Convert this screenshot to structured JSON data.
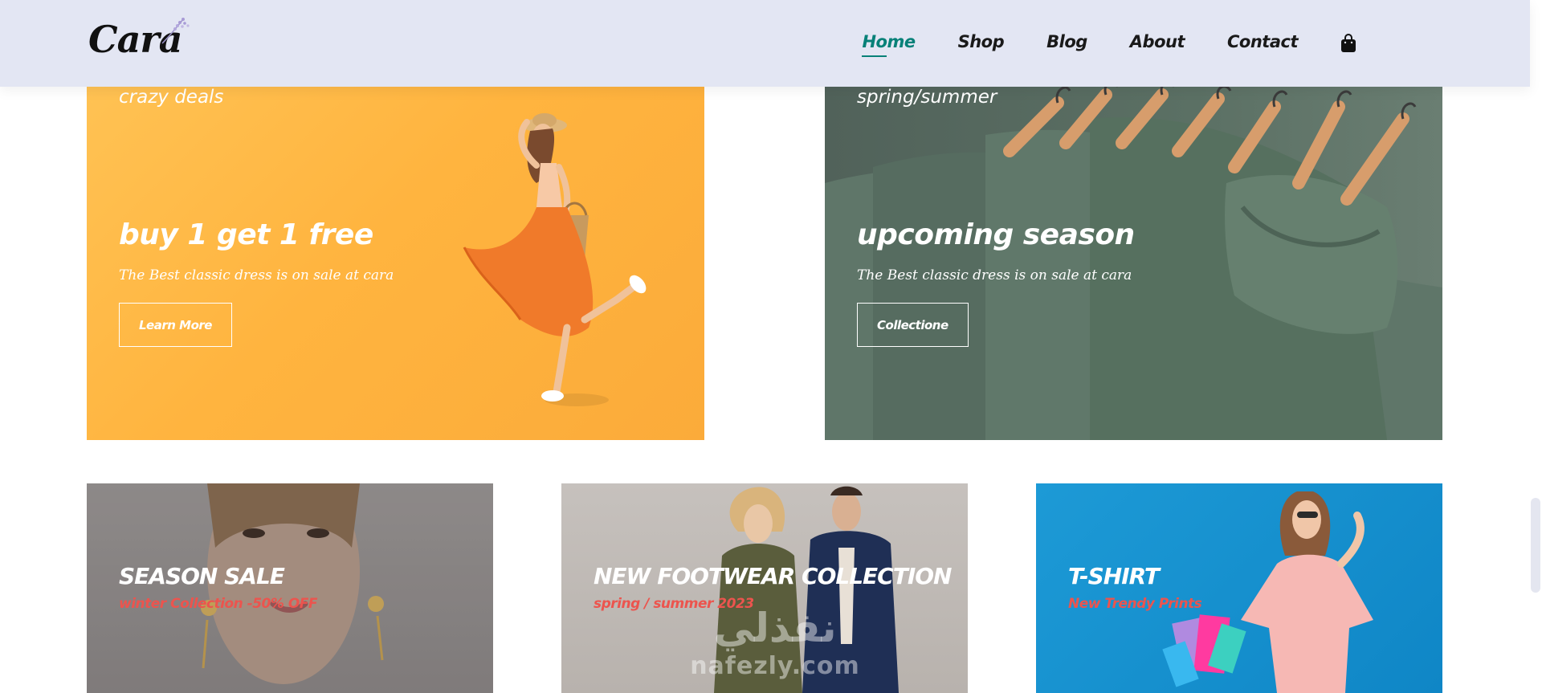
{
  "logo": {
    "text": "Cara"
  },
  "nav": {
    "items": [
      {
        "label": "Home",
        "active": true
      },
      {
        "label": "Shop",
        "active": false
      },
      {
        "label": "Blog",
        "active": false
      },
      {
        "label": "About",
        "active": false
      },
      {
        "label": "Contact",
        "active": false
      }
    ],
    "cart_icon": "shopping-bag-icon"
  },
  "banners_top": [
    {
      "small": "crazy deals",
      "big": "buy 1 get 1 free",
      "desc": "The Best classic dress is on sale at cara",
      "button": "Learn More"
    },
    {
      "small": "spring/summer",
      "big": "upcoming season",
      "desc": "The Best classic dress is on sale at cara",
      "button": "Collectione"
    }
  ],
  "banners_bottom": [
    {
      "title": "SEASON SALE",
      "subtitle": "winter Collection -50% OFF"
    },
    {
      "title": "NEW FOOTWEAR COLLECTION",
      "subtitle": "spring / summer 2023"
    },
    {
      "title": "T-SHIRT",
      "subtitle": "New Trendy Prints"
    }
  ],
  "watermark": {
    "arabic": "نفذلي",
    "latin": "nafezly.com"
  },
  "colors": {
    "header_bg": "#e3e6f3",
    "accent": "#088178",
    "sale_red": "#ec544e"
  }
}
